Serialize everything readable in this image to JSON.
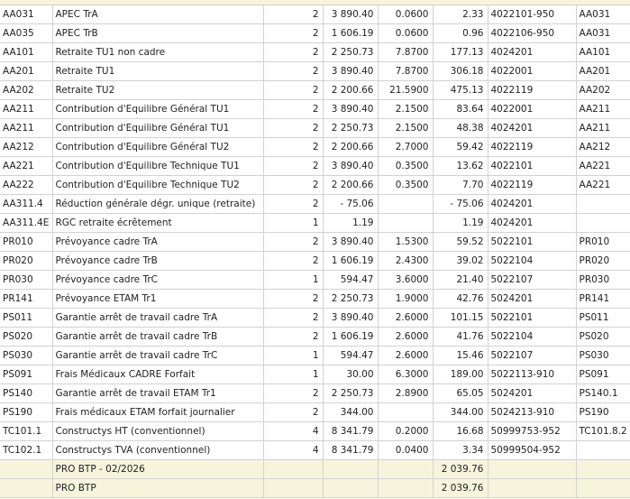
{
  "rows": [
    [
      "AA031",
      "APEC TrA",
      "2",
      "3 890.40",
      "0.0600",
      "2.33",
      "4022101-950",
      "AA031"
    ],
    [
      "AA035",
      "APEC TrB",
      "2",
      "1 606.19",
      "0.0600",
      "0.96",
      "4022106-950",
      "AA031"
    ],
    [
      "AA101",
      "Retraite TU1 non cadre",
      "2",
      "2 250.73",
      "7.8700",
      "177.13",
      "4024201",
      "AA101"
    ],
    [
      "AA201",
      "Retraite TU1",
      "2",
      "3 890.40",
      "7.8700",
      "306.18",
      "4022001",
      "AA201"
    ],
    [
      "AA202",
      "Retraite TU2",
      "2",
      "2 200.66",
      "21.5900",
      "475.13",
      "4022119",
      "AA202"
    ],
    [
      "AA211",
      "Contribution d'Equilibre Général TU1",
      "2",
      "3 890.40",
      "2.1500",
      "83.64",
      "4022001",
      "AA211"
    ],
    [
      "AA211",
      "Contribution d'Equilibre Général TU1",
      "2",
      "2 250.73",
      "2.1500",
      "48.38",
      "4024201",
      "AA211"
    ],
    [
      "AA212",
      "Contribution d'Equilibre Général TU2",
      "2",
      "2 200.66",
      "2.7000",
      "59.42",
      "4022119",
      "AA212"
    ],
    [
      "AA221",
      "Contribution d'Equilibre Technique TU1",
      "2",
      "3 890.40",
      "0.3500",
      "13.62",
      "4022101",
      "AA221"
    ],
    [
      "AA222",
      "Contribution d'Equilibre Technique TU2",
      "2",
      "2 200.66",
      "0.3500",
      "7.70",
      "4022119",
      "AA221"
    ],
    [
      "AA311.4",
      "Réduction générale dégr. unique (retraite)",
      "2",
      "- 75.06",
      "",
      "- 75.06",
      "4024201",
      ""
    ],
    [
      "AA311.4E",
      "RGC retraite écrêtement",
      "1",
      "1.19",
      "",
      "1.19",
      "4024201",
      ""
    ],
    [
      "PR010",
      "Prévoyance cadre TrA",
      "2",
      "3 890.40",
      "1.5300",
      "59.52",
      "5022101",
      "PR010"
    ],
    [
      "PR020",
      "Prévoyance cadre TrB",
      "2",
      "1 606.19",
      "2.4300",
      "39.02",
      "5022104",
      "PR020"
    ],
    [
      "PR030",
      "Prévoyance cadre TrC",
      "1",
      "594.47",
      "3.6000",
      "21.40",
      "5022107",
      "PR030"
    ],
    [
      "PR141",
      "Prévoyance ETAM Tr1",
      "2",
      "2 250.73",
      "1.9000",
      "42.76",
      "5024201",
      "PR141"
    ],
    [
      "PS011",
      "Garantie arrêt de travail cadre TrA",
      "2",
      "3 890.40",
      "2.6000",
      "101.15",
      "5022101",
      "PS011"
    ],
    [
      "PS020",
      "Garantie arrêt de travail cadre TrB",
      "2",
      "1 606.19",
      "2.6000",
      "41.76",
      "5022104",
      "PS020"
    ],
    [
      "PS030",
      "Garantie arrêt de travail cadre TrC",
      "1",
      "594.47",
      "2.6000",
      "15.46",
      "5022107",
      "PS030"
    ],
    [
      "PS091",
      "Frais Médicaux CADRE Forfait",
      "1",
      "30.00",
      "6.3000",
      "189.00",
      "5022113-910",
      "PS091"
    ],
    [
      "PS140",
      "Garantie arrêt de travail ETAM Tr1",
      "2",
      "2 250.73",
      "2.8900",
      "65.05",
      "5024201",
      "PS140.1"
    ],
    [
      "PS190",
      "Frais médicaux ETAM forfait journalier",
      "2",
      "344.00",
      "",
      "344.00",
      "5024213-910",
      "PS190"
    ],
    [
      "TC101.1",
      "Constructys HT (conventionnel)",
      "4",
      "8 341.79",
      "0.2000",
      "16.68",
      "50999753-952",
      "TC101.8.2"
    ],
    [
      "TC102.1",
      "Constructys TVA (conventionnel)",
      "4",
      "8 341.79",
      "0.0400",
      "3.34",
      "50999504-952",
      ""
    ]
  ],
  "totals": [
    {
      "label": "PRO BTP - 02/2026",
      "amount": "2 039.76"
    },
    {
      "label": "PRO BTP",
      "amount": "2 039.76"
    }
  ]
}
